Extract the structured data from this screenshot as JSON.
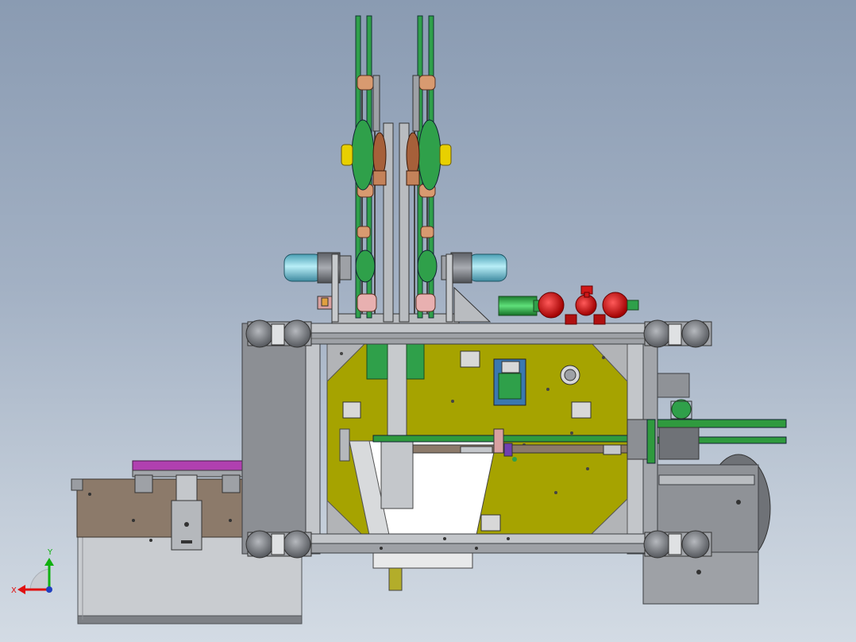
{
  "viewport": {
    "background_top": "#8a9bb2",
    "background_bottom": "#d3dbe4"
  },
  "axis_triad": {
    "x_label": "X",
    "y_label": "Y",
    "x_color": "#e01010",
    "y_color": "#10b010",
    "z_color": "#2040c0"
  },
  "colors": {
    "frame_gray": "#8c8f94",
    "frame_light": "#c3c6ca",
    "panel_olive": "#a6a300",
    "gear_green": "#2fa04a",
    "motor_cyan": "#7fd6e6",
    "pump_red": "#d01818",
    "hub_yellow": "#e8d000",
    "plate_purple": "#b040b0",
    "plate_brown": "#8c7a6a"
  }
}
